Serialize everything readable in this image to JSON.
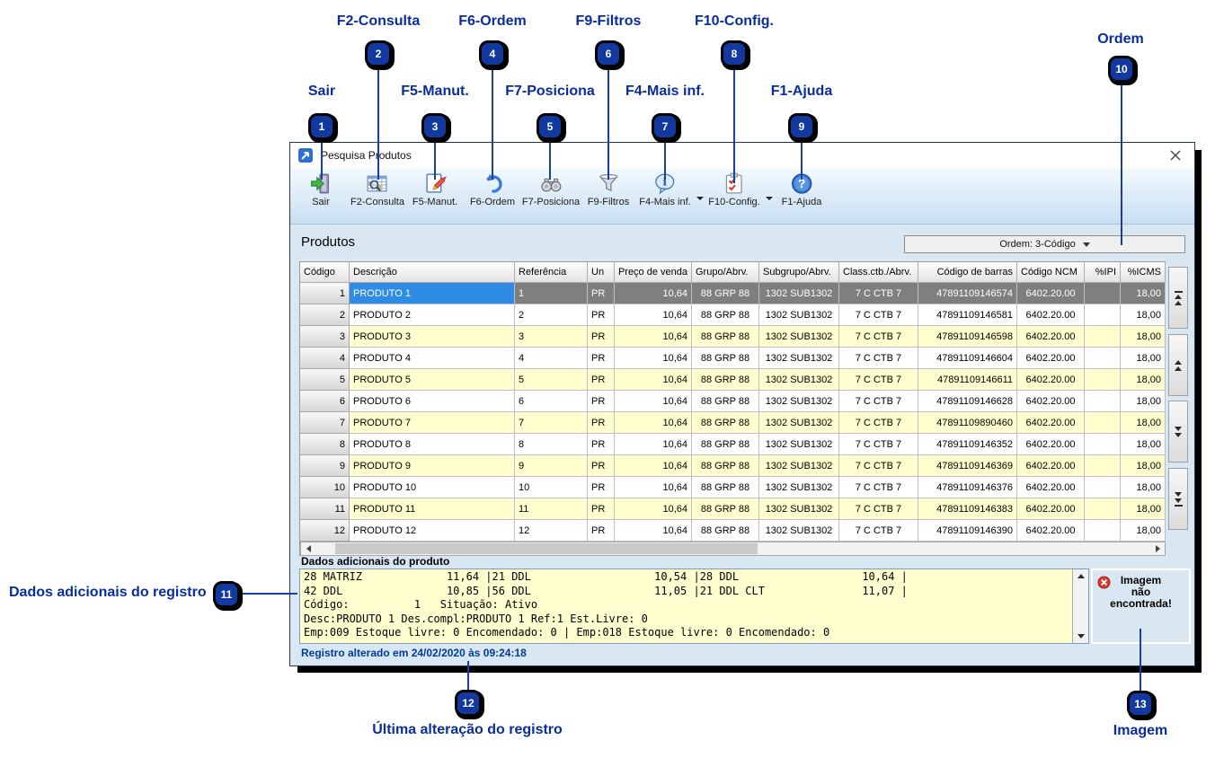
{
  "callouts": [
    {
      "num": "1",
      "label": "Sair"
    },
    {
      "num": "2",
      "label": "F2-Consulta"
    },
    {
      "num": "3",
      "label": "F5-Manut."
    },
    {
      "num": "4",
      "label": "F6-Ordem"
    },
    {
      "num": "5",
      "label": "F7-Posiciona"
    },
    {
      "num": "6",
      "label": "F9-Filtros"
    },
    {
      "num": "7",
      "label": "F4-Mais inf."
    },
    {
      "num": "8",
      "label": "F10-Config."
    },
    {
      "num": "9",
      "label": "F1-Ajuda"
    },
    {
      "num": "10",
      "label": "Ordem"
    },
    {
      "num": "11",
      "label": "Dados adicionais do registro"
    },
    {
      "num": "12",
      "label": "Última alteração do registro"
    },
    {
      "num": "13",
      "label": "Imagem"
    }
  ],
  "colors": {
    "annotation_navy": "#0a2d9c",
    "badge_blue": "#11399f",
    "selected_row_gray": "#7f7f7f",
    "selected_cell_blue": "#2e8be6",
    "alt_row_yellow": "#ffffcf",
    "window_bg_blue": "#d8e7f2",
    "error_red": "#d93a2b"
  },
  "window": {
    "title": "Pesquisa Produtos",
    "toolbar": [
      {
        "label": "Sair"
      },
      {
        "label": "F2-Consulta"
      },
      {
        "label": "F5-Manut."
      },
      {
        "label": "F6-Ordem"
      },
      {
        "label": "F7-Posiciona"
      },
      {
        "label": "F9-Filtros"
      },
      {
        "label": "F4-Mais inf."
      },
      {
        "label": "F10-Config."
      },
      {
        "label": "F1-Ajuda"
      }
    ],
    "section_title": "Produtos",
    "order_dropdown_value": "Ordem: 3-Código",
    "grid": {
      "columns": [
        "Código",
        "Descrição",
        "Referência",
        "Un",
        "Preço de venda",
        "Grupo/Abrv.",
        "Subgrupo/Abrv.",
        "Class.ctb./Abrv.",
        "Código de barras",
        "Código NCM",
        "%IPI",
        "%ICMS"
      ],
      "selected_codigo": "1",
      "rows": [
        [
          "1",
          "PRODUTO 1",
          "1",
          "PR",
          "10,64",
          "88 GRP 88",
          "1302 SUB1302",
          "7 C CTB 7",
          "47891109146574",
          "6402.20.00",
          "",
          "18,00"
        ],
        [
          "2",
          "PRODUTO 2",
          "2",
          "PR",
          "10,64",
          "88 GRP 88",
          "1302 SUB1302",
          "7 C CTB 7",
          "47891109146581",
          "6402.20.00",
          "",
          "18,00"
        ],
        [
          "3",
          "PRODUTO 3",
          "3",
          "PR",
          "10,64",
          "88 GRP 88",
          "1302 SUB1302",
          "7 C CTB 7",
          "47891109146598",
          "6402.20.00",
          "",
          "18,00"
        ],
        [
          "4",
          "PRODUTO 4",
          "4",
          "PR",
          "10,64",
          "88 GRP 88",
          "1302 SUB1302",
          "7 C CTB 7",
          "47891109146604",
          "6402.20.00",
          "",
          "18,00"
        ],
        [
          "5",
          "PRODUTO 5",
          "5",
          "PR",
          "10,64",
          "88 GRP 88",
          "1302 SUB1302",
          "7 C CTB 7",
          "47891109146611",
          "6402.20.00",
          "",
          "18,00"
        ],
        [
          "6",
          "PRODUTO 6",
          "6",
          "PR",
          "10,64",
          "88 GRP 88",
          "1302 SUB1302",
          "7 C CTB 7",
          "47891109146628",
          "6402.20.00",
          "",
          "18,00"
        ],
        [
          "7",
          "PRODUTO 7",
          "7",
          "PR",
          "10,64",
          "88 GRP 88",
          "1302 SUB1302",
          "7 C CTB 7",
          "47891109890460",
          "6402.20.00",
          "",
          "18,00"
        ],
        [
          "8",
          "PRODUTO 8",
          "8",
          "PR",
          "10,64",
          "88 GRP 88",
          "1302 SUB1302",
          "7 C CTB 7",
          "47891109146352",
          "6402.20.00",
          "",
          "18,00"
        ],
        [
          "9",
          "PRODUTO 9",
          "9",
          "PR",
          "10,64",
          "88 GRP 88",
          "1302 SUB1302",
          "7 C CTB 7",
          "47891109146369",
          "6402.20.00",
          "",
          "18,00"
        ],
        [
          "10",
          "PRODUTO 10",
          "10",
          "PR",
          "10,64",
          "88 GRP 88",
          "1302 SUB1302",
          "7 C CTB 7",
          "47891109146376",
          "6402.20.00",
          "",
          "18,00"
        ],
        [
          "11",
          "PRODUTO 11",
          "11",
          "PR",
          "10,64",
          "88 GRP 88",
          "1302 SUB1302",
          "7 C CTB 7",
          "47891109146383",
          "6402.20.00",
          "",
          "18,00"
        ],
        [
          "12",
          "PRODUTO 12",
          "12",
          "PR",
          "10,64",
          "88 GRP 88",
          "1302 SUB1302",
          "7 C CTB 7",
          "47891109146390",
          "6402.20.00",
          "",
          "18,00"
        ]
      ]
    },
    "details_header": "Dados adicionais do produto",
    "details_lines": [
      "28 MATRIZ             11,64 |21 DDL                   10,54 |28 DDL                   10,64 |",
      "42 DDL                10,85 |56 DDL                   11,05 |21 DDL CLT               11,07 |",
      "Código:          1   Situação: Ativo",
      "Desc:PRODUTO 1 Des.compl:PRODUTO 1 Ref:1 Est.Livre: 0",
      "Emp:009 Estoque livre: 0 Encomendado: 0 | Emp:018 Estoque livre: 0 Encomendado: 0"
    ],
    "image_box": [
      "Imagem",
      "não",
      "encontrada!"
    ],
    "status": "Registro alterado em 24/02/2020 às 09:24:18"
  }
}
